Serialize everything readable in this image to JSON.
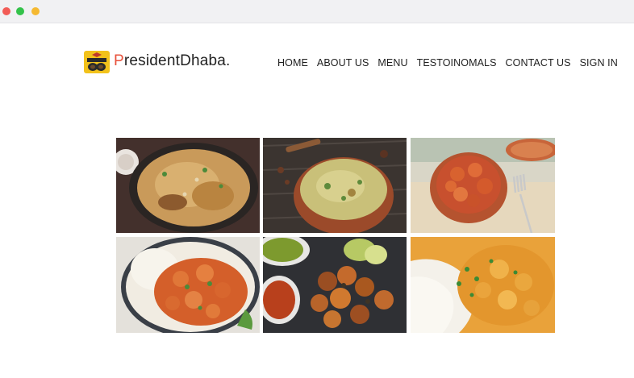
{
  "window": {
    "controls": [
      "close",
      "minimize",
      "maximize"
    ]
  },
  "header": {
    "brand_first": "P",
    "brand_rest": "residentDhaba.",
    "logo_icon": "president-dhaba-logo-icon"
  },
  "nav": {
    "items": [
      {
        "label": "HOME"
      },
      {
        "label": "ABOUT US"
      },
      {
        "label": "MENU"
      },
      {
        "label": "TESTOINOMALS"
      },
      {
        "label": "CONTACT US"
      },
      {
        "label": "SIGN IN"
      }
    ]
  },
  "gallery": {
    "images": [
      {
        "name": "biryani-pan-image"
      },
      {
        "name": "biryani-bowl-image"
      },
      {
        "name": "chilli-chicken-bowl-image"
      },
      {
        "name": "butter-chicken-rice-image"
      },
      {
        "name": "tandoori-tikka-chutney-image"
      },
      {
        "name": "chicken-curry-rice-image"
      }
    ]
  },
  "colors": {
    "brand_accent": "#e8503a",
    "nav_text": "#1f1f1f",
    "logo_yellow": "#f2c21b"
  }
}
